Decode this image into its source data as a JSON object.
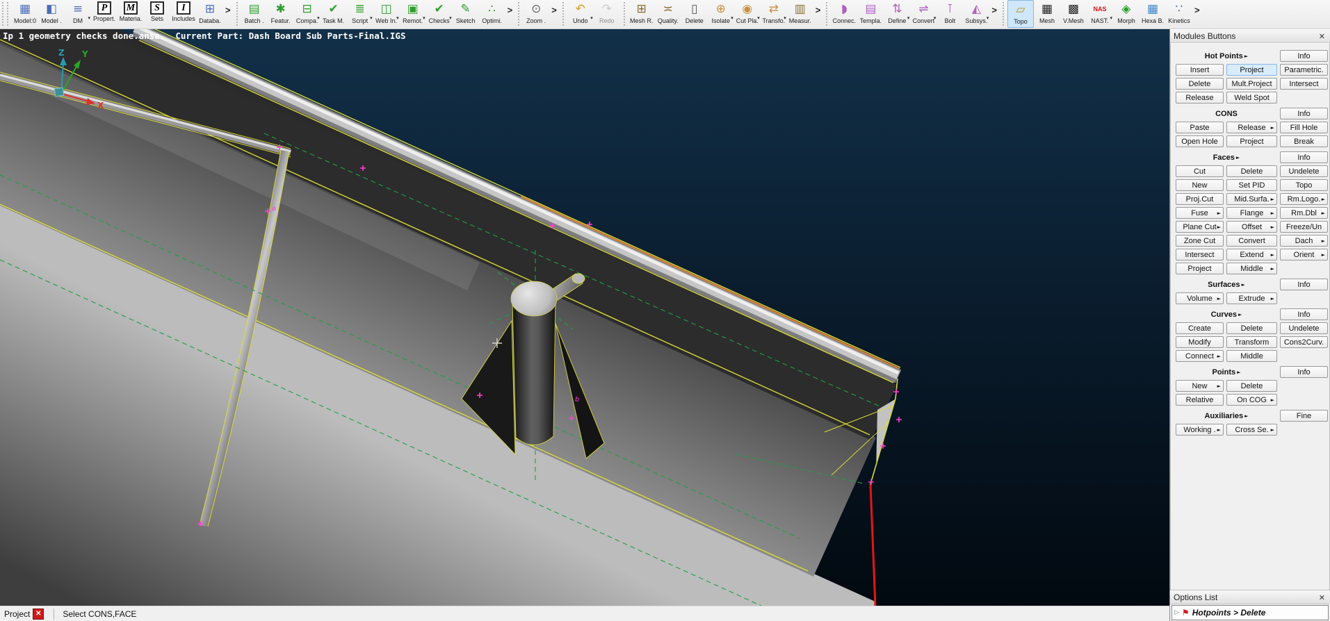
{
  "colors": {
    "edge_yellow": "#d9d93a",
    "dashed_green": "#1fa040",
    "marker_magenta": "#ff3ed2",
    "break_red": "#e31616",
    "axis_x": "#e03030",
    "axis_y": "#28a828",
    "axis_z": "#2a9ab0",
    "selection_fill": "#d9ecfc",
    "selection_border": "#86b8e8",
    "viewport_top": "#123049",
    "viewport_bottom": "#020910"
  },
  "toolbar": {
    "groups": [
      {
        "color": "#4a6db8",
        "overflow": true,
        "items": [
          {
            "label": "Model:0",
            "icon": "model-tree"
          },
          {
            "label": "Model .",
            "icon": "model"
          },
          {
            "label": "DM",
            "icon": "dm-browser",
            "caret": true
          },
          {
            "label": "Propert.",
            "icon": "properties",
            "boxed": "P"
          },
          {
            "label": "Materia.",
            "icon": "materials",
            "boxed": "M"
          },
          {
            "label": "Sets",
            "icon": "sets",
            "boxed": "S"
          },
          {
            "label": "Includes",
            "icon": "includes",
            "boxed": "I"
          },
          {
            "label": "Databa.",
            "icon": "database"
          }
        ]
      },
      {
        "color": "#2f9e2f",
        "overflow": true,
        "items": [
          {
            "label": "Batch .",
            "icon": "batch"
          },
          {
            "label": "Featur.",
            "icon": "feature"
          },
          {
            "label": "Compa.",
            "icon": "compare",
            "caret": true
          },
          {
            "label": "Task M.",
            "icon": "task-manager"
          },
          {
            "label": "Script",
            "icon": "script",
            "caret": true
          },
          {
            "label": "Web In.",
            "icon": "web-interface",
            "caret": true
          },
          {
            "label": "Remot.",
            "icon": "remote",
            "caret": true
          },
          {
            "label": "Checks",
            "icon": "checks",
            "caret": true
          },
          {
            "label": "Sketch",
            "icon": "sketch"
          },
          {
            "label": "Optimi.",
            "icon": "optimizer"
          }
        ]
      },
      {
        "color": "#666666",
        "overflow": true,
        "items": [
          {
            "label": "Zoom .",
            "icon": "zoom"
          }
        ]
      },
      {
        "color": "#d8a020",
        "overflow": false,
        "items": [
          {
            "label": "Undo",
            "icon": "undo",
            "caret": true
          },
          {
            "label": "Redo",
            "icon": "redo",
            "color": "#9a9a9a",
            "disabled": true
          }
        ]
      },
      {
        "color": "#8a6a30",
        "overflow": true,
        "items": [
          {
            "label": "Mesh R.",
            "icon": "mesh-parameters"
          },
          {
            "label": "Quality.",
            "icon": "quality-criteria"
          },
          {
            "label": "Delete",
            "icon": "delete",
            "color": "#555555"
          },
          {
            "label": "Isolate",
            "icon": "isolate",
            "color": "#c89040",
            "caret": true
          },
          {
            "label": "Cut Pla.",
            "icon": "cut-plane",
            "color": "#c89040",
            "caret": true
          },
          {
            "label": "Transfo.",
            "icon": "transform",
            "color": "#c89040",
            "caret": true
          },
          {
            "label": "Measur.",
            "icon": "measure"
          }
        ]
      },
      {
        "color": "#b060c0",
        "overflow": true,
        "items": [
          {
            "label": "Connec.",
            "icon": "connections"
          },
          {
            "label": "Templa.",
            "icon": "template"
          },
          {
            "label": "Define",
            "icon": "define",
            "caret": true
          },
          {
            "label": "Convert",
            "icon": "convert",
            "caret": true
          },
          {
            "label": "Bolt",
            "icon": "bolt"
          },
          {
            "label": "Subsys.",
            "icon": "subsystems",
            "caret": true
          }
        ]
      },
      {
        "color": "#222222",
        "overflow": true,
        "items": [
          {
            "label": "Topo",
            "icon": "topo",
            "color": "#b89a10",
            "selected": true
          },
          {
            "label": "Mesh",
            "icon": "mesh"
          },
          {
            "label": "V.Mesh",
            "icon": "volume-mesh"
          },
          {
            "label": "NAST.",
            "icon": "nastran",
            "caret": true
          },
          {
            "label": "Morph",
            "icon": "morph",
            "color": "#22a022"
          },
          {
            "label": "Hexa B.",
            "icon": "hexa-block",
            "color": "#3f86c8"
          },
          {
            "label": "Kinetics",
            "icon": "kinetics",
            "color": "#5668c0"
          }
        ]
      }
    ]
  },
  "viewport": {
    "info_text": "Ip 1 geometry checks done.ansa.  Current Part: Dash Board Sub Parts-Final.IGS",
    "axis": {
      "x": "X",
      "y": "Y",
      "z": "Z"
    },
    "annotations": {
      "a": "a",
      "b": "b"
    }
  },
  "modules_panel": {
    "title": "Modules Buttons",
    "close_label": "✕",
    "sections": [
      {
        "header": "Hot Points",
        "arrow": true,
        "side_btn": "Info",
        "rows": [
          [
            "Insert",
            {
              "label": "Project",
              "selected": true
            },
            "Parametric."
          ],
          [
            "Delete",
            "Mult.Project",
            "Intersect"
          ],
          [
            "Release",
            "Weld Spot",
            null
          ]
        ]
      },
      {
        "header": "CONS",
        "arrow": false,
        "side_btn": "Info",
        "rows": [
          [
            "Paste",
            {
              "label": "Release",
              "arrow": true
            },
            "Fill Hole"
          ],
          [
            "Open Hole",
            "Project",
            "Break"
          ]
        ]
      },
      {
        "header": "Faces",
        "arrow": true,
        "side_btn": "Info",
        "rows": [
          [
            "Cut",
            "Delete",
            "Undelete"
          ],
          [
            "New",
            "Set PID",
            "Topo"
          ],
          [
            "Proj.Cut",
            {
              "label": "Mid.Surfa.",
              "arrow": true
            },
            {
              "label": "Rm.Logo.",
              "arrow": true
            }
          ],
          [
            {
              "label": "Fuse",
              "arrow": true
            },
            {
              "label": "Flange",
              "arrow": true
            },
            {
              "label": "Rm.Dbl",
              "arrow": true
            }
          ],
          [
            {
              "label": "Plane Cut",
              "arrow": true
            },
            {
              "label": "Offset",
              "arrow": true
            },
            "Freeze/Un"
          ],
          [
            "Zone Cut",
            "Convert",
            {
              "label": "Dach",
              "arrow": true
            }
          ],
          [
            "Intersect",
            {
              "label": "Extend",
              "arrow": true
            },
            {
              "label": "Orient",
              "arrow": true
            }
          ],
          [
            "Project",
            {
              "label": "Middle",
              "arrow": true
            },
            null
          ]
        ]
      },
      {
        "header": "Surfaces",
        "arrow": true,
        "side_btn": "Info",
        "rows": [
          [
            {
              "label": "Volume",
              "arrow": true
            },
            {
              "label": "Extrude",
              "arrow": true
            },
            null
          ]
        ]
      },
      {
        "header": "Curves",
        "arrow": true,
        "side_btn": "Info",
        "rows": [
          [
            "Create",
            "Delete",
            "Undelete"
          ],
          [
            "Modify",
            "Transform",
            "Cons2Curv."
          ],
          [
            {
              "label": "Connect",
              "arrow": true
            },
            "Middle",
            null
          ]
        ]
      },
      {
        "header": "Points",
        "arrow": true,
        "side_btn": "Info",
        "rows": [
          [
            {
              "label": "New",
              "arrow": true
            },
            "Delete",
            null
          ],
          [
            "Relative",
            {
              "label": "On COG",
              "arrow": true
            },
            null
          ]
        ]
      },
      {
        "header": "Auxiliaries",
        "arrow": true,
        "side_btn": "Fine",
        "rows": [
          [
            {
              "label": "Working .",
              "arrow": true
            },
            {
              "label": "Cross Se.",
              "arrow": true
            },
            null
          ]
        ]
      }
    ]
  },
  "options_panel": {
    "title": "Options List",
    "close_label": "✕",
    "expander": "▷",
    "flag_icon": "⚑",
    "items": [
      {
        "label": "Hotpoints > Delete"
      }
    ]
  },
  "status_bar": {
    "project_label": "Project",
    "close_icon": "✕",
    "message": "Select CONS,FACE"
  }
}
